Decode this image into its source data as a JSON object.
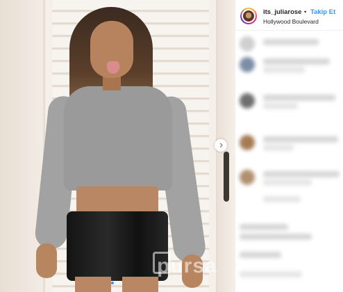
{
  "post": {
    "username": "its_juliarose",
    "separator": "•",
    "follow_label": "Takip Et",
    "location": "Hollywood Boulevard",
    "watermark": "pursa"
  },
  "colors": {
    "accent": "#3897f0",
    "text": "#262626"
  },
  "icons": {
    "next": "chevron-right-icon"
  },
  "carousel": {
    "total": 2,
    "active": 1
  }
}
